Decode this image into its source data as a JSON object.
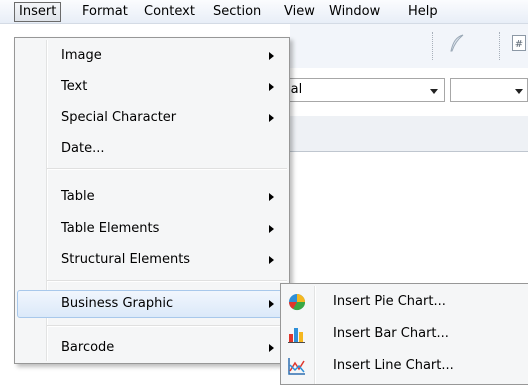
{
  "menubar": {
    "items": [
      "Insert",
      "Format",
      "Context",
      "Section",
      "View",
      "Window",
      "Help"
    ]
  },
  "background": {
    "font_combo_value": "ial",
    "size_combo_value": ""
  },
  "insert_menu": {
    "items": [
      {
        "label": "Image",
        "submenu": true
      },
      {
        "label": "Text",
        "submenu": true
      },
      {
        "label": "Special Character",
        "submenu": true
      },
      {
        "label": "Date...",
        "submenu": false
      },
      {
        "label": "Table",
        "submenu": true
      },
      {
        "label": "Table Elements",
        "submenu": true
      },
      {
        "label": "Structural Elements",
        "submenu": true
      },
      {
        "label": "Business Graphic",
        "submenu": true,
        "highlighted": true
      },
      {
        "label": "Barcode",
        "submenu": true
      }
    ]
  },
  "business_graphic_submenu": {
    "items": [
      {
        "label": "Insert Pie Chart...",
        "icon": "pie-chart-icon"
      },
      {
        "label": "Insert Bar Chart...",
        "icon": "bar-chart-icon"
      },
      {
        "label": "Insert Line Chart...",
        "icon": "line-chart-icon"
      }
    ]
  },
  "colors": {
    "highlight_border": "#a8c8eb",
    "highlight_fill": "#dbe9f9",
    "menu_bg": "#f5f6f7"
  }
}
